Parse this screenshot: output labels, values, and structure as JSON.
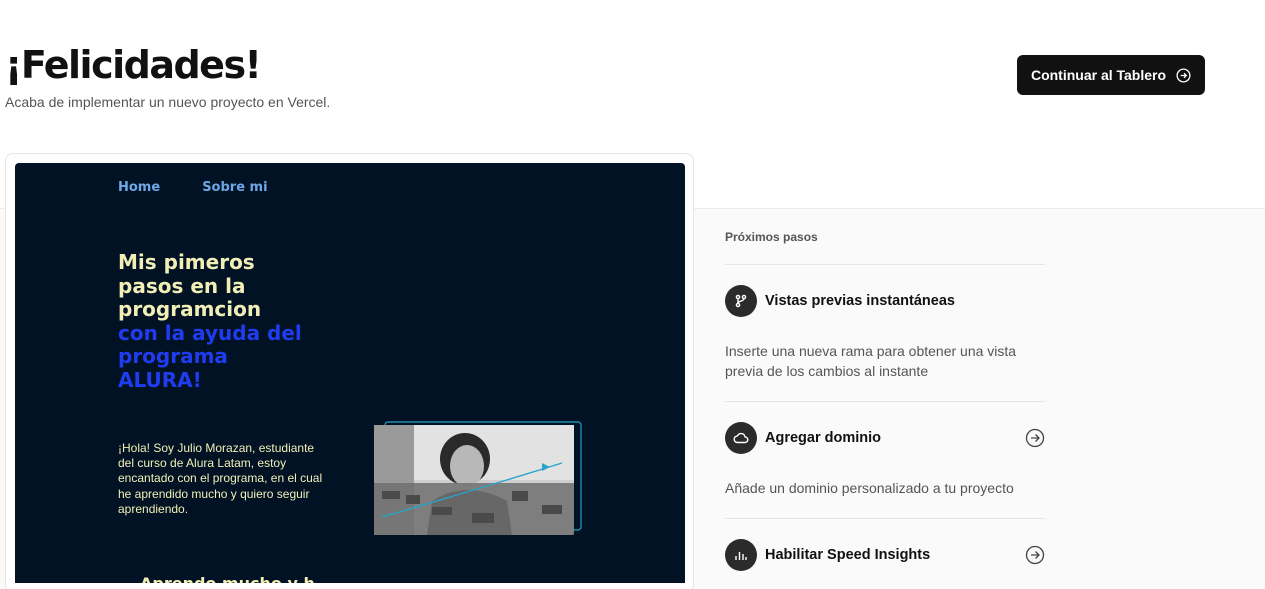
{
  "header": {
    "title": "¡Felicidades!",
    "subtitle": "Acaba de implementar un nuevo proyecto en Vercel.",
    "continue_label": "Continuar al Tablero",
    "continue_icon": "arrow-right-circle-icon"
  },
  "preview": {
    "nav": [
      "Home",
      "Sobre mi"
    ],
    "hero_title_light": [
      "Mis pimeros",
      "pasos en la",
      "programcion"
    ],
    "hero_title_blue": [
      "con la ayuda del",
      "programa",
      "ALURA!"
    ],
    "hero_text": "¡Hola! Soy Julio Morazan, estudiante del curso de Alura Latam, estoy encantado con el programa, en el cual he aprendido mucho y quiero seguir aprendiendo.",
    "photo_alt": "portrait-photo"
  },
  "next_steps": {
    "title": "Próximos pasos",
    "items": [
      {
        "icon": "git-branch-icon",
        "title": "Vistas previas instantáneas",
        "description": "Inserte una nueva rama para obtener una vista previa de los cambios al instante",
        "arrow": false
      },
      {
        "icon": "cloud-icon",
        "title": "Agregar dominio",
        "description": "Añade un dominio personalizado a tu proyecto",
        "arrow": true
      },
      {
        "icon": "bar-chart-icon",
        "title": "Habilitar Speed Insights",
        "description": "",
        "arrow": true
      }
    ]
  },
  "colors": {
    "accent_dark": "#111111",
    "preview_bg": "#001224",
    "hero_light": "#f2efb6",
    "hero_blue": "#1f3cf0",
    "nav_link": "#6ea8e6"
  }
}
